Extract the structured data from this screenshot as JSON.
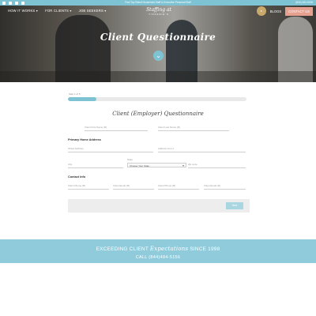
{
  "topbar": {
    "announce": "Find Top Rated Household Staff & Executive Personal Staff ",
    "phone": "(844) 484-5156"
  },
  "nav": {
    "menu": [
      "HOW IT WORKS ▾",
      "FOR CLIENTS ▾",
      "JOB SEEKERS ▾"
    ],
    "logo_line1": "Staffing at",
    "logo_line2": "TIFFANIE'S",
    "blogs": "BLOGS",
    "contact": "CONTACT US"
  },
  "hero": {
    "title": "Client Questionnaire",
    "arrow": "⌄"
  },
  "form": {
    "progress_label": "Step 1 of 5",
    "progress_fraction": 0.16,
    "title": "Client (Employer) Questionnaire",
    "first_name": "Client First Name (R)",
    "last_name": "Client Last Name (R)",
    "section_home": "Primary Home Address",
    "street": "Street Address",
    "address2": "Address Line 2",
    "city": "City",
    "state_label": "State",
    "state_value": "Choose Your State",
    "zip": "Zip code",
    "section_contact": "Contact Info",
    "phone1": "Client Phone (R)",
    "email1": "Client Email (R)",
    "phone2": "Client Phone (R)",
    "email2": "Client Email (R)",
    "next_button": "Next"
  },
  "footer": {
    "line1_pre": "EXCEEDING CLIENT ",
    "line1_em": "Expectations",
    "line1_post": " SINCE 1998",
    "line2": "CALL (844)484-5156"
  },
  "colors": {
    "accent": "#7ec3d3",
    "footer": "#8fcbdb",
    "contact": "#e6a090"
  }
}
